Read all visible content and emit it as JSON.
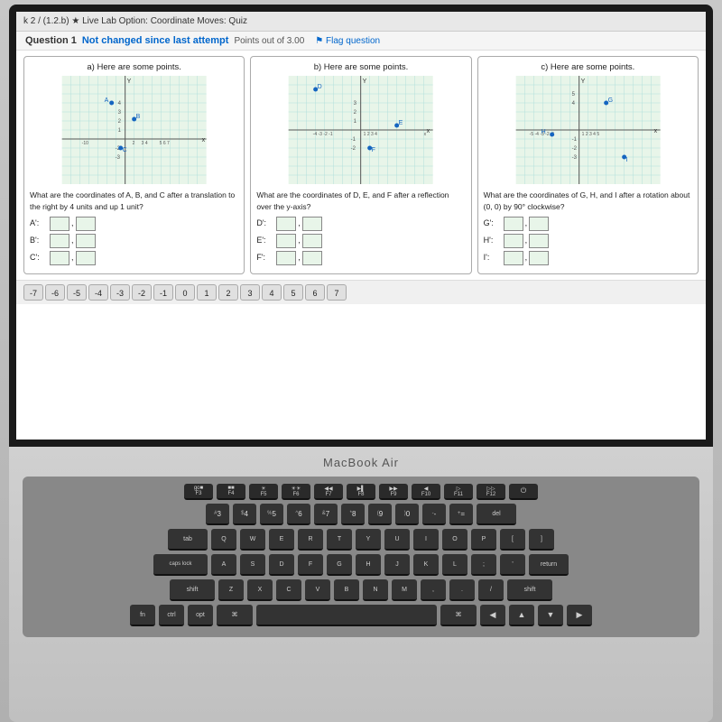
{
  "browser": {
    "title": "k 2 / (1.2.b) ★ Live Lab Option: Coordinate Moves: Quiz"
  },
  "question": {
    "number": "Question 1",
    "status": "Not changed since last attempt",
    "points": "Points out of 3.00",
    "flag": "⚑ Flag question"
  },
  "panels": [
    {
      "id": "panel-a",
      "title": "a) Here are some points.",
      "description": "What are the coordinates of A, B, and C after a translation to the right by 4 units and up 1 unit?",
      "inputs": [
        {
          "label": "A':",
          "x": "",
          "y": ""
        },
        {
          "label": "B':",
          "x": "",
          "y": ""
        },
        {
          "label": "C':",
          "x": "",
          "y": ""
        }
      ]
    },
    {
      "id": "panel-b",
      "title": "b) Here are some points.",
      "description": "What are the coordinates of D, E, and F after a reflection over the y-axis?",
      "inputs": [
        {
          "label": "D':",
          "x": "",
          "y": ""
        },
        {
          "label": "E':",
          "x": "",
          "y": ""
        },
        {
          "label": "F':",
          "x": "",
          "y": ""
        }
      ]
    },
    {
      "id": "panel-c",
      "title": "c) Here are some points.",
      "description": "What are the coordinates of G, H, and I after a rotation about (0, 0) by 90° clockwise?",
      "inputs": [
        {
          "label": "G':",
          "x": "",
          "y": ""
        },
        {
          "label": "H':",
          "x": "",
          "y": ""
        },
        {
          "label": "I':",
          "x": "",
          "y": ""
        }
      ]
    }
  ],
  "number_buttons": [
    "-7",
    "-6",
    "-5",
    "-4",
    "-3",
    "-2",
    "-1",
    "0",
    "1",
    "2",
    "3",
    "4",
    "5",
    "6",
    "7"
  ],
  "keyboard": {
    "brand": "MacBook Air",
    "fn_row": [
      "go ■ F3",
      "■■■ F4",
      "☀ F5",
      "☀☀ F6",
      "◀◀ F7",
      "▶▌ F8",
      "▶▶ F9",
      "◀ F10",
      "▷ F11",
      "▷▷ F12",
      "⏻"
    ],
    "row1": [
      "#\n3",
      "$\n4",
      "%\n5",
      "^\n6",
      "&\n7",
      "*\n8",
      "(\n9",
      ")\n0",
      "-\n-",
      "+\n=",
      "del"
    ],
    "row2": [
      "Q",
      "W",
      "E",
      "R",
      "T",
      "Y",
      "U",
      "I",
      "O",
      "P",
      "[\n{",
      "}\n]"
    ],
    "row3": [
      "A",
      "S",
      "D",
      "F",
      "G",
      "H",
      "J",
      "K",
      "L",
      ";\n:",
      "'\n\""
    ],
    "row4": [
      "Z",
      "X",
      "C",
      "V",
      "B",
      "N",
      "M",
      ",\n<",
      ".\n>",
      "/\n?"
    ]
  }
}
